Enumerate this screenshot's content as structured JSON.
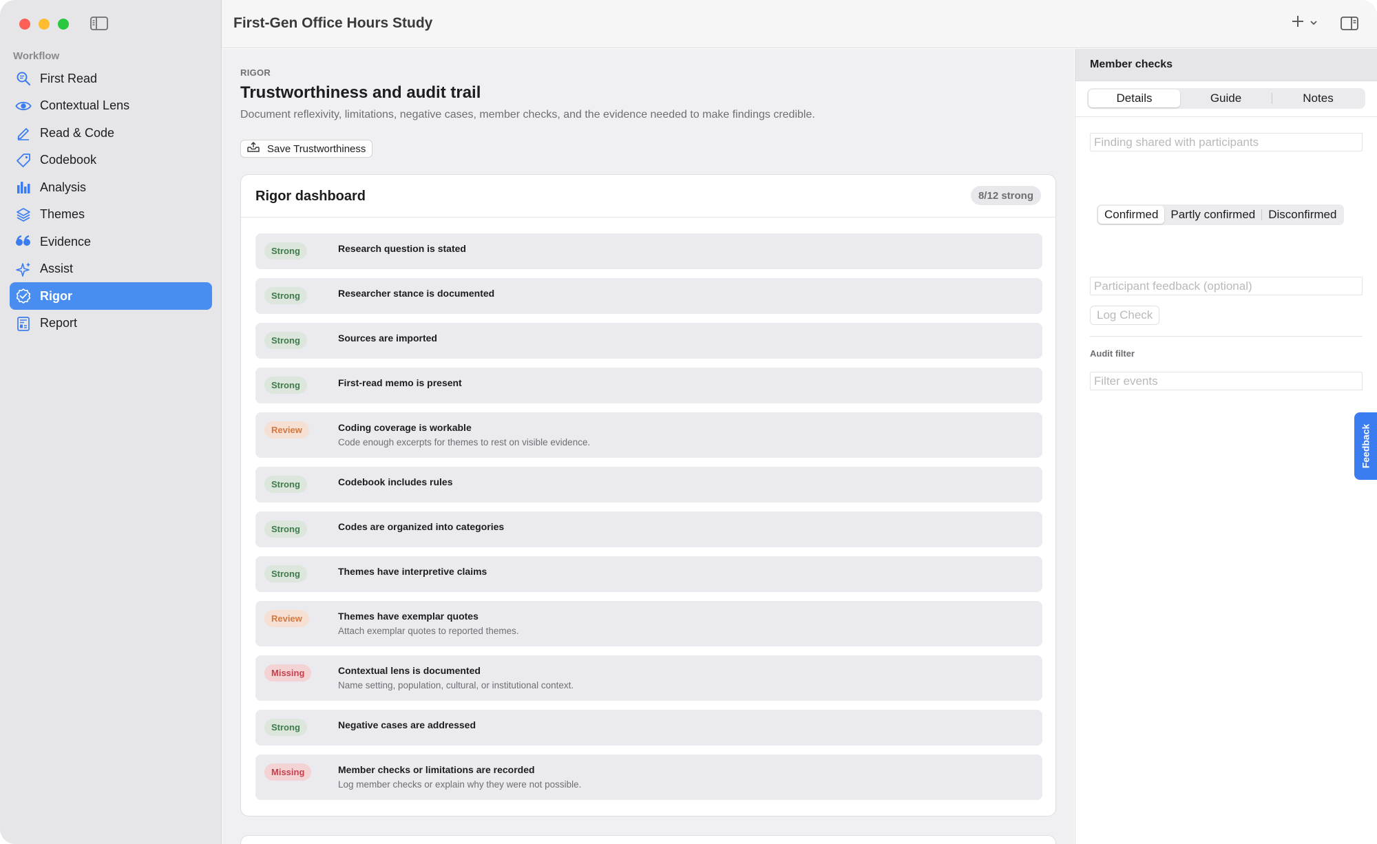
{
  "window": {
    "title": "First-Gen Office Hours Study"
  },
  "sidebar": {
    "section_label": "Workflow",
    "items": [
      {
        "label": "First Read",
        "icon": "magnifier-doc-icon"
      },
      {
        "label": "Contextual Lens",
        "icon": "eye-icon"
      },
      {
        "label": "Read & Code",
        "icon": "pencil-icon"
      },
      {
        "label": "Codebook",
        "icon": "tag-icon"
      },
      {
        "label": "Analysis",
        "icon": "bar-chart-icon"
      },
      {
        "label": "Themes",
        "icon": "layers-icon"
      },
      {
        "label": "Evidence",
        "icon": "quote-icon"
      },
      {
        "label": "Assist",
        "icon": "sparkle-icon"
      },
      {
        "label": "Rigor",
        "icon": "check-seal-icon",
        "active": true
      },
      {
        "label": "Report",
        "icon": "report-icon"
      }
    ]
  },
  "main": {
    "eyebrow": "RIGOR",
    "title": "Trustworthiness and audit trail",
    "description": "Document reflexivity, limitations, negative cases, member checks, and the evidence needed to make findings credible.",
    "save_label": "Save Trustworthiness",
    "dashboard": {
      "title": "Rigor dashboard",
      "badge": "8/12 strong",
      "checks": [
        {
          "status": "Strong",
          "title": "Research question is stated",
          "detail": ""
        },
        {
          "status": "Strong",
          "title": "Researcher stance is documented",
          "detail": ""
        },
        {
          "status": "Strong",
          "title": "Sources are imported",
          "detail": ""
        },
        {
          "status": "Strong",
          "title": "First-read memo is present",
          "detail": ""
        },
        {
          "status": "Review",
          "title": "Coding coverage is workable",
          "detail": "Code enough excerpts for themes to rest on visible evidence."
        },
        {
          "status": "Strong",
          "title": "Codebook includes rules",
          "detail": ""
        },
        {
          "status": "Strong",
          "title": "Codes are organized into categories",
          "detail": ""
        },
        {
          "status": "Strong",
          "title": "Themes have interpretive claims",
          "detail": ""
        },
        {
          "status": "Review",
          "title": "Themes have exemplar quotes",
          "detail": "Attach exemplar quotes to reported themes."
        },
        {
          "status": "Missing",
          "title": "Contextual lens is documented",
          "detail": "Name setting, population, cultural, or institutional context."
        },
        {
          "status": "Strong",
          "title": "Negative cases are addressed",
          "detail": ""
        },
        {
          "status": "Missing",
          "title": "Member checks or limitations are recorded",
          "detail": "Log member checks or explain why they were not possible."
        }
      ]
    }
  },
  "inspector": {
    "title": "Member checks",
    "tabs": [
      "Details",
      "Guide",
      "Notes"
    ],
    "selected_tab": "Details",
    "finding_placeholder": "Finding shared with participants",
    "outcomes": [
      "Confirmed",
      "Partly confirmed",
      "Disconfirmed"
    ],
    "selected_outcome": "Confirmed",
    "feedback_placeholder": "Participant feedback (optional)",
    "log_label": "Log Check",
    "audit_label": "Audit filter",
    "audit_placeholder": "Filter events"
  },
  "feedback_tab": "Feedback",
  "colors": {
    "accent": "#4a8df0",
    "strong_text": "#3f7a4a",
    "review_text": "#d2783f",
    "missing_text": "#c6414d"
  }
}
